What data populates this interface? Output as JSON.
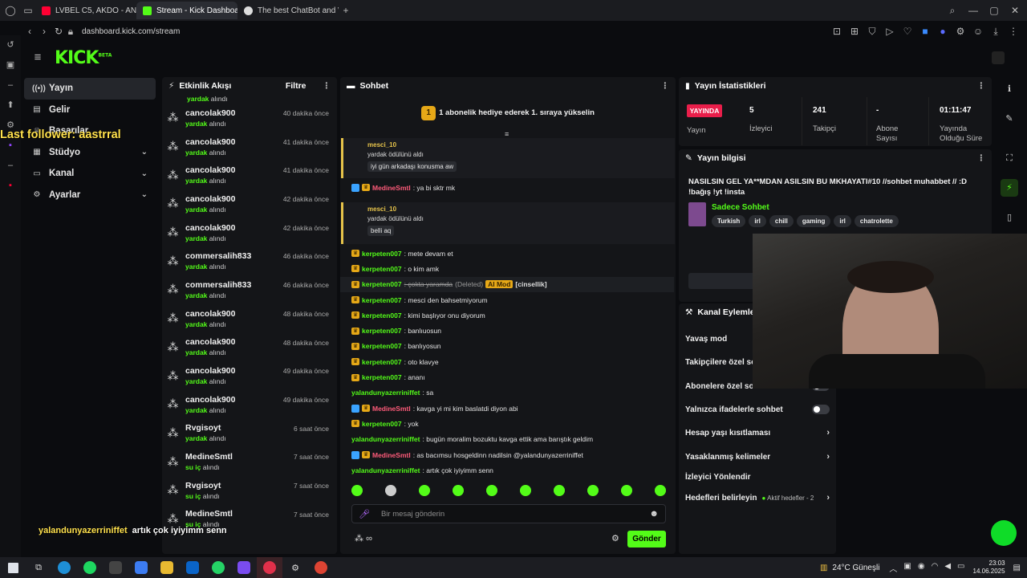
{
  "browser": {
    "tabs": [
      {
        "label": "LVBEL C5, AKDO - ANLAD",
        "color": "#ff0033"
      },
      {
        "label": "Stream - Kick Dashboard",
        "color": "#53fc18"
      },
      {
        "label": "The best ChatBot and We",
        "color": "#dddddd"
      }
    ],
    "url": "dashboard.kick.com/stream"
  },
  "header": {
    "logo": "KICK",
    "logo_sup": "BETA"
  },
  "sidebar": {
    "items": [
      {
        "label": "Yayın",
        "icon": "broadcast-icon"
      },
      {
        "label": "Gelir",
        "icon": "money-icon"
      },
      {
        "label": "Başarılar",
        "icon": "trophy-icon"
      },
      {
        "label": "Stüdyo",
        "icon": "studio-icon"
      },
      {
        "label": "Kanal",
        "icon": "channel-icon"
      },
      {
        "label": "Ayarlar",
        "icon": "gear-icon"
      }
    ]
  },
  "overlay": {
    "follower": "Last follower: aastrral",
    "bottom_user": "yalandunyazerriniffet",
    "bottom_msg": "artık çok iyiyimm senn"
  },
  "activity": {
    "title": "Etkinlik Akışı",
    "filter": "Filtre",
    "top_sub": "yardak alındı",
    "rows": [
      {
        "name": "cancolak900",
        "sub_g": "yardak",
        "sub": "alındı",
        "time": "40 dakika önce"
      },
      {
        "name": "cancolak900",
        "sub_g": "yardak",
        "sub": "alındı",
        "time": "41 dakika önce"
      },
      {
        "name": "cancolak900",
        "sub_g": "yardak",
        "sub": "alındı",
        "time": "41 dakika önce"
      },
      {
        "name": "cancolak900",
        "sub_g": "yardak",
        "sub": "alındı",
        "time": "42 dakika önce"
      },
      {
        "name": "cancolak900",
        "sub_g": "yardak",
        "sub": "alındı",
        "time": "42 dakika önce"
      },
      {
        "name": "commersalih833",
        "sub_g": "yardak",
        "sub": "alındı",
        "time": "46 dakika önce"
      },
      {
        "name": "commersalih833",
        "sub_g": "yardak",
        "sub": "alındı",
        "time": "46 dakika önce"
      },
      {
        "name": "cancolak900",
        "sub_g": "yardak",
        "sub": "alındı",
        "time": "48 dakika önce"
      },
      {
        "name": "cancolak900",
        "sub_g": "yardak",
        "sub": "alındı",
        "time": "48 dakika önce"
      },
      {
        "name": "cancolak900",
        "sub_g": "yardak",
        "sub": "alındı",
        "time": "49 dakika önce"
      },
      {
        "name": "cancolak900",
        "sub_g": "yardak",
        "sub": "alındı",
        "time": "49 dakika önce"
      },
      {
        "name": "Rvgisoyt",
        "sub_g": "yardak",
        "sub": "alındı",
        "time": "6 saat önce"
      },
      {
        "name": "MedineSmtl",
        "sub_g": "su iç",
        "sub": "alındı",
        "time": "7 saat önce"
      },
      {
        "name": "Rvgisoyt",
        "sub_g": "su iç",
        "sub": "alındı",
        "time": "7 saat önce"
      },
      {
        "name": "MedineSmtl",
        "sub_g": "su iç",
        "sub": "alındı",
        "time": "7 saat önce"
      }
    ]
  },
  "chat": {
    "title": "Sohbet",
    "pinned_num": "1",
    "pinned": "1 abonelik hediye ederek 1. sıraya yükselin",
    "reply1": {
      "user": "mesci_10",
      "text": "yardak ödülünü aldı",
      "msg": "iyi gün arkadaşı konusma aw"
    },
    "line_medine1": {
      "user": "MedineSmtl",
      "text": ": ya bi sktr mk"
    },
    "reply2": {
      "user": "mesci_10",
      "text": "yardak ödülünü aldı",
      "msg": "belli aq"
    },
    "lines": [
      {
        "user": "kerpeten007",
        "text": ": mete devam et",
        "color": "#53fc18"
      },
      {
        "user": "kerpeten007",
        "text": ": o kim amk",
        "color": "#53fc18"
      },
      {
        "user": "kerpeten007",
        "text": ": çokta yaramda",
        "color": "#53fc18"
      },
      {
        "user": "kerpeten007",
        "text": ": mesci den bahsetmiyorum",
        "color": "#53fc18"
      },
      {
        "user": "kerpeten007",
        "text": ": kimi başlıyor onu diyorum",
        "color": "#53fc18"
      },
      {
        "user": "kerpeten007",
        "text": ": banlıuosun",
        "color": "#53fc18"
      },
      {
        "user": "kerpeten007",
        "text": ": banlıyosun",
        "color": "#53fc18"
      },
      {
        "user": "kerpeten007",
        "text": ": oto klavye",
        "color": "#53fc18"
      },
      {
        "user": "kerpeten007",
        "text": ": ananı",
        "color": "#53fc18"
      },
      {
        "user": "yalandunyazerriniffet",
        "text": ": sa",
        "color": "#53fc18"
      },
      {
        "user": "MedineSmtl",
        "text": ": kavga yi mi kim baslatdi diyon abi",
        "color": "#ff5b7a"
      },
      {
        "user": "kerpeten007",
        "text": ": yok",
        "color": "#53fc18"
      },
      {
        "user": "yalandunyazerriniffet",
        "text": ": bugün moralim bozuktu kavga ettik ama barıştık geldim",
        "color": "#53fc18"
      },
      {
        "user": "MedineSmtl",
        "text": ": as bacımsu hosgeldinn nadilsin @yalandunyazerriniffet",
        "color": "#ff5b7a"
      },
      {
        "user": "yalandunyazerriniffet",
        "text": ": artık çok iyiyimm senn",
        "color": "#53fc18"
      }
    ],
    "deleted_label": "(Deleted)",
    "mod_label": "AI Mod",
    "deleted_reason": "[cinsellik]",
    "input_placeholder": "Bir mesaj gönderin",
    "send_label": "Gönder",
    "points": "∞"
  },
  "stats": {
    "title": "Yayın İstatistikleri",
    "live_badge": "YAYINDA",
    "live_label": "Yayın",
    "viewers": "5",
    "viewers_label": "İzleyici",
    "followers": "241",
    "followers_label": "Takipçi",
    "subs": "-",
    "subs_label": "Abone Sayısı",
    "duration": "01:11:47",
    "duration_label": "Yayında Olduğu Süre"
  },
  "info": {
    "title": "Yayın bilgisi",
    "stream_title": "NASILSIN GEL YA**MDAN ASILSIN BU MKHAYATI#10 //sohbet muhabbet // :D !bağış !yt !insta",
    "category": "Sadece Sohbet",
    "tags": [
      "Turkish",
      "irl",
      "chill",
      "gaming",
      "irl",
      "chatrolette"
    ]
  },
  "actions": {
    "title": "Kanal Eylemleri",
    "items": [
      {
        "label": "Yavaş mod",
        "kind": "toggle"
      },
      {
        "label": "Takipçilere özel so",
        "kind": "toggle"
      },
      {
        "label": "Abonelere özel sohbet",
        "kind": "toggle"
      },
      {
        "label": "Yalnızca ifadelerle sohbet",
        "kind": "toggle"
      },
      {
        "label": "Hesap yaşı kısıtlaması",
        "kind": "chev"
      },
      {
        "label": "Yasaklanmış kelimeler",
        "kind": "chev"
      },
      {
        "label": "İzleyici Yönlendir",
        "kind": "none"
      },
      {
        "label": "Hedefleri belirleyin",
        "kind": "goal"
      }
    ],
    "goal_note": "Aktif hedefler - 2"
  },
  "taskbar": {
    "weather": "24°C Güneşli",
    "time": "23:03",
    "date": "14.06.2025"
  },
  "colors": {
    "accent": "#53fc18",
    "live": "#e91e4a"
  }
}
